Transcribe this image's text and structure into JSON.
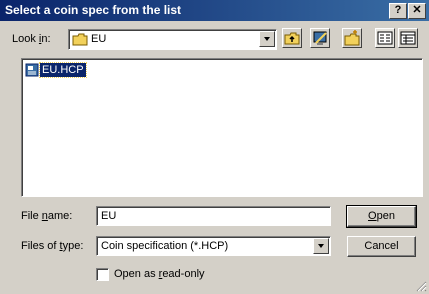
{
  "window": {
    "title": "Select a coin spec from the list",
    "help_glyph": "?",
    "close_glyph": "✕"
  },
  "look_in": {
    "label_pre": "Look ",
    "label_accel": "i",
    "label_post": "n:",
    "value": "EU",
    "icon": "folder-icon"
  },
  "toolbar": {
    "icons": [
      "up-folder-icon",
      "desktop-icon",
      "new-folder-icon",
      "list-view-icon",
      "details-view-icon"
    ]
  },
  "file_list": {
    "items": [
      {
        "name": "EU.HCP",
        "icon": "file-icon",
        "selected": true
      }
    ]
  },
  "file_name": {
    "label_pre": "File ",
    "label_accel": "n",
    "label_post": "ame:",
    "value": "EU"
  },
  "files_of_type": {
    "label_pre": "Files of ",
    "label_accel": "t",
    "label_post": "ype:",
    "value": "Coin specification (*.HCP)"
  },
  "read_only": {
    "label_pre": "Open as ",
    "label_accel": "r",
    "label_post": "ead-only",
    "checked": false
  },
  "buttons": {
    "open_accel": "O",
    "open_rest": "pen",
    "cancel": "Cancel"
  },
  "colors": {
    "title_start": "#0a246a",
    "title_end": "#3a6ea5",
    "dialog_face": "#d4d0c8",
    "selection": "#0a246a",
    "folder_yellow": "#f2d15b"
  }
}
